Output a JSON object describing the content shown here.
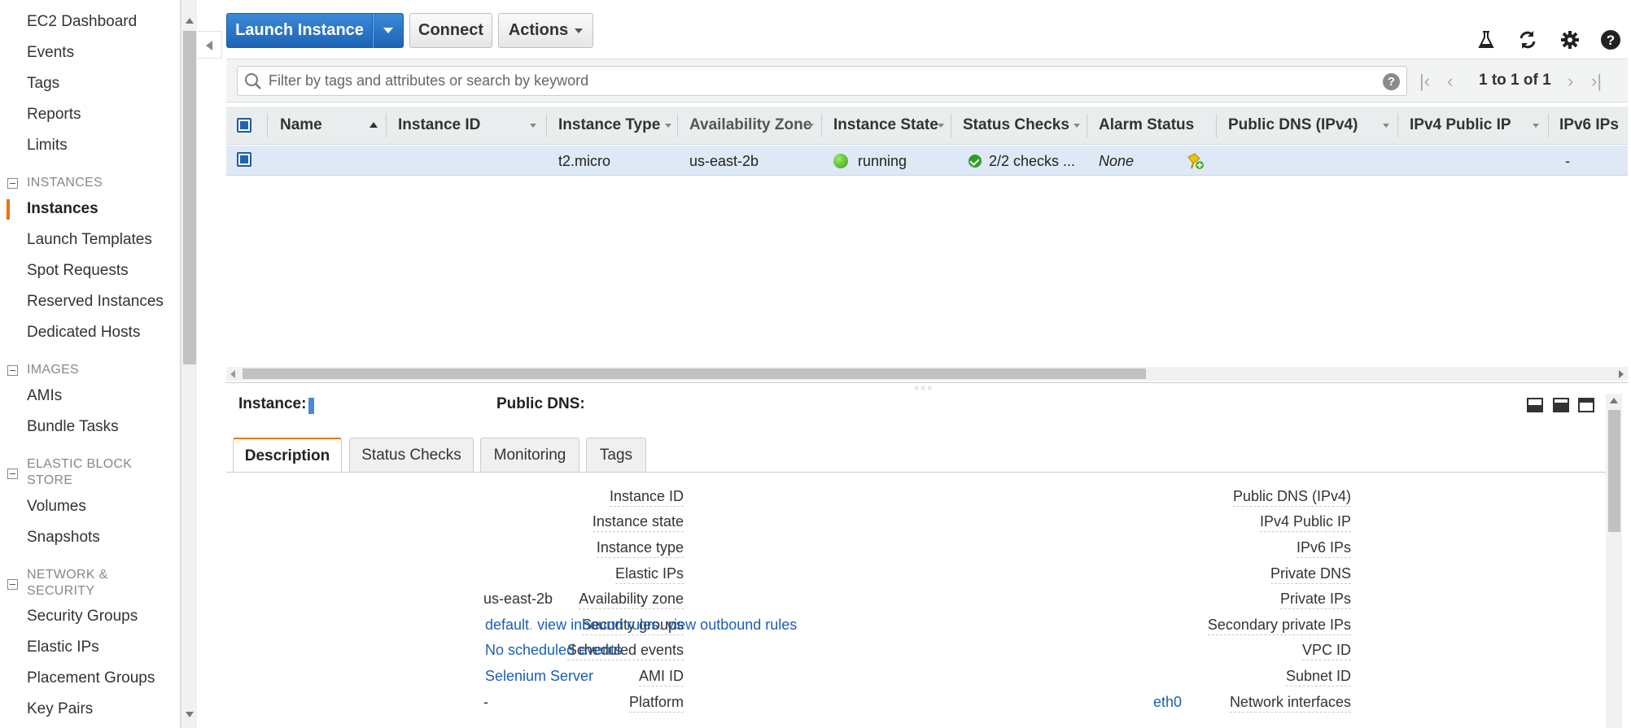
{
  "sidebar": {
    "top_items": [
      "EC2 Dashboard",
      "Events",
      "Tags",
      "Reports",
      "Limits"
    ],
    "sections": [
      {
        "title": "INSTANCES",
        "items": [
          "Instances",
          "Launch Templates",
          "Spot Requests",
          "Reserved Instances",
          "Dedicated Hosts"
        ]
      },
      {
        "title": "IMAGES",
        "items": [
          "AMIs",
          "Bundle Tasks"
        ]
      },
      {
        "title_line1": "ELASTIC BLOCK",
        "title_line2": "STORE",
        "items": [
          "Volumes",
          "Snapshots"
        ]
      },
      {
        "title_line1": "NETWORK &",
        "title_line2": "SECURITY",
        "items": [
          "Security Groups",
          "Elastic IPs",
          "Placement Groups",
          "Key Pairs"
        ]
      }
    ],
    "active_item": "Instances"
  },
  "toolbar": {
    "launch_label": "Launch Instance",
    "connect_label": "Connect",
    "actions_label": "Actions"
  },
  "filter": {
    "placeholder": "Filter by tags and attributes or search by keyword",
    "value": "",
    "pagination": "1 to 1 of 1"
  },
  "table": {
    "columns": [
      "Name",
      "Instance ID",
      "Instance Type",
      "Availability Zone",
      "Instance State",
      "Status Checks",
      "Alarm Status",
      "Public DNS (IPv4)",
      "IPv4 Public IP",
      "IPv6 IPs"
    ],
    "row": {
      "name": "",
      "instance_id": "",
      "instance_type": "t2.micro",
      "availability_zone": "us-east-2b",
      "instance_state": "running",
      "status_checks": "2/2 checks ...",
      "alarm_status": "None",
      "public_dns": "",
      "ipv4_public_ip": "",
      "ipv6_ips": "-"
    }
  },
  "details": {
    "instance_label": "Instance:",
    "public_dns_label": "Public DNS:",
    "tabs": [
      "Description",
      "Status Checks",
      "Monitoring",
      "Tags"
    ],
    "active_tab": "Description",
    "left": {
      "labels": [
        "Instance ID",
        "Instance state",
        "Instance type",
        "Elastic IPs",
        "Availability zone",
        "Security groups",
        "Scheduled events",
        "AMI ID",
        "Platform"
      ],
      "availability_zone": "us-east-2b",
      "security_group": "default",
      "view_inbound": "view inbound rules",
      "view_outbound": "view outbound rules",
      "scheduled_events": "No scheduled events",
      "ami_id": "Selenium Server",
      "platform": "-"
    },
    "right": {
      "labels": [
        "Public DNS (IPv4)",
        "IPv4 Public IP",
        "IPv6 IPs",
        "Private DNS",
        "Private IPs",
        "Secondary private IPs",
        "VPC ID",
        "Subnet ID",
        "Network interfaces"
      ],
      "network_interfaces": "eth0"
    }
  },
  "colors": {
    "accent": "#ec7211",
    "primary_button": "#1e63b6",
    "link": "#1a5fb4",
    "running": "#3aa013"
  }
}
